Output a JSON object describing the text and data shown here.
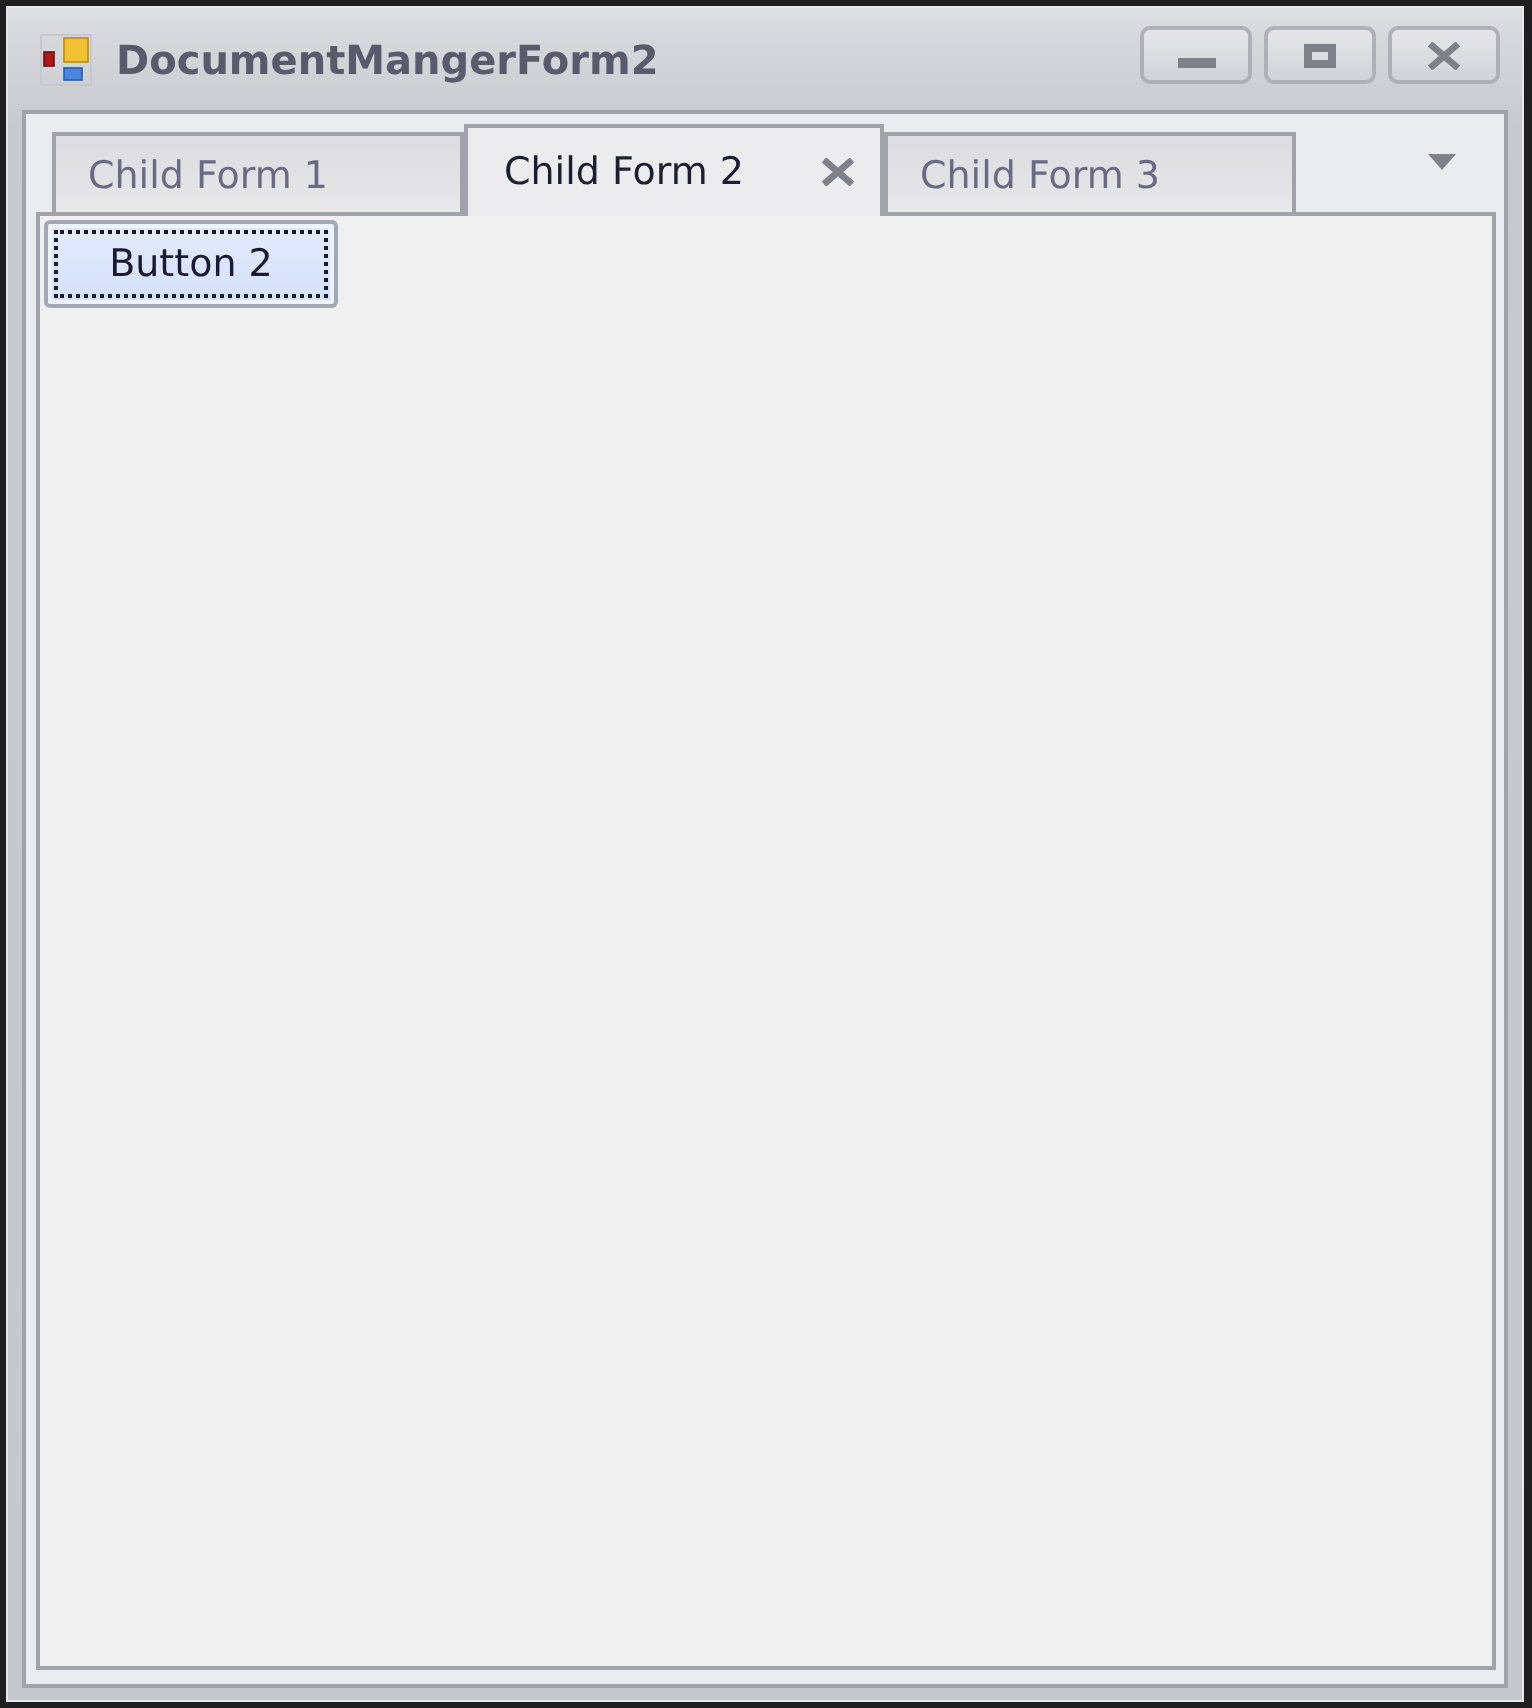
{
  "window": {
    "title": "DocumentMangerForm2"
  },
  "tabs": [
    {
      "label": "Child Form 1",
      "selected": false
    },
    {
      "label": "Child Form 2",
      "selected": true
    },
    {
      "label": "Child Form 3",
      "selected": false
    }
  ],
  "panel": {
    "buttons": [
      {
        "label": "Button 2",
        "focused": true
      }
    ]
  }
}
